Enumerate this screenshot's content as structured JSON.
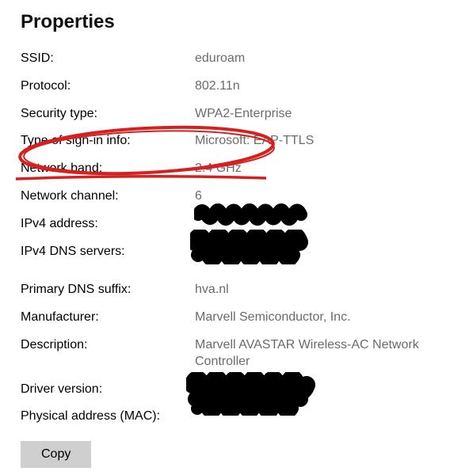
{
  "heading": "Properties",
  "rows": [
    {
      "label": "SSID:",
      "value": "eduroam"
    },
    {
      "label": "Protocol:",
      "value": "802.11n"
    },
    {
      "label": "Security type:",
      "value": "WPA2-Enterprise"
    },
    {
      "label": "Type of sign-in info:",
      "value": "Microsoft: EAP-TTLS"
    },
    {
      "label": "Network band:",
      "value": "2.4 GHz"
    },
    {
      "label": "Network channel:",
      "value": "6"
    },
    {
      "label": "IPv4 address:",
      "value": " "
    },
    {
      "label": "IPv4 DNS servers:",
      "value": " "
    },
    {
      "label": "Primary DNS suffix:",
      "value": "hva.nl"
    },
    {
      "label": "Manufacturer:",
      "value": "Marvell Semiconductor, Inc."
    },
    {
      "label": "Description:",
      "value": "Marvell AVASTAR Wireless-AC Network Controller"
    },
    {
      "label": "Driver version:",
      "value": " "
    },
    {
      "label": "Physical address (MAC):",
      "value": " "
    }
  ],
  "copy_label": "Copy",
  "annotations": {
    "circle_color": "#d6201f",
    "redaction_color": "#000000"
  }
}
